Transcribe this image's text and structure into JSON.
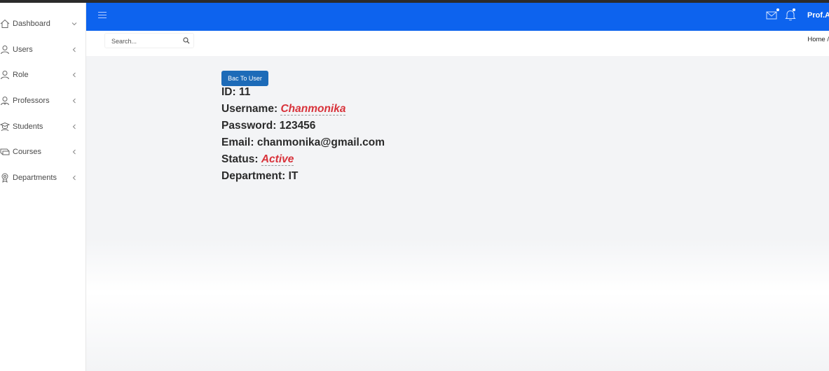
{
  "sidebar": {
    "items": [
      {
        "label": "Dashboard",
        "icon": "home-icon",
        "chevron": "chevron-down-icon"
      },
      {
        "label": "Users",
        "icon": "users-icon",
        "chevron": "chevron-left-icon"
      },
      {
        "label": "Role",
        "icon": "role-icon",
        "chevron": "chevron-left-icon"
      },
      {
        "label": "Professors",
        "icon": "professor-icon",
        "chevron": "chevron-left-icon"
      },
      {
        "label": "Students",
        "icon": "students-icon",
        "chevron": "chevron-left-icon"
      },
      {
        "label": "Courses",
        "icon": "courses-icon",
        "chevron": "chevron-left-icon"
      },
      {
        "label": "Departments",
        "icon": "departments-icon",
        "chevron": "chevron-left-icon"
      }
    ]
  },
  "header": {
    "profile_name": "Prof.A",
    "accent_color": "#0d63ee"
  },
  "search": {
    "placeholder": "Search..."
  },
  "breadcrumb": "Home /",
  "back_button_label": "Bac To User",
  "user": {
    "id_label": "ID:",
    "id_value": "11",
    "username_label": "Username:",
    "username_value": "Chanmonika",
    "password_label": "Password:",
    "password_value": "123456",
    "email_label": "Email:",
    "email_value": "chanmonika@gmail.com",
    "status_label": "Status:",
    "status_value": "Active",
    "department_label": "Department:",
    "department_value": "IT"
  },
  "colors": {
    "highlight": "#d8323a",
    "button": "#1d6bb8"
  }
}
